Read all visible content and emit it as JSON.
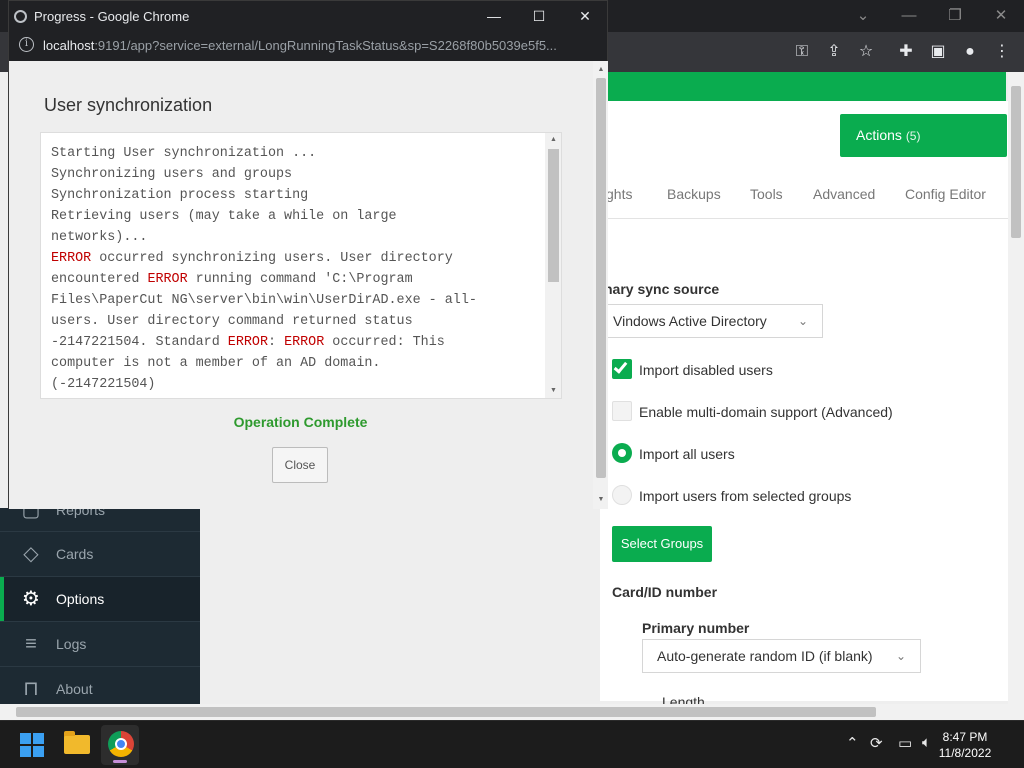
{
  "popup": {
    "window_title": "Progress - Google Chrome",
    "url_host": "localhost",
    "url_rest": ":9191/app?service=external/LongRunningTaskStatus&sp=S2268f80b5039e5f5...",
    "heading": "User synchronization",
    "log_lines": [
      {
        "parts": [
          {
            "t": "Starting User synchronization ...",
            "e": false
          }
        ]
      },
      {
        "parts": [
          {
            "t": "Synchronizing users and groups",
            "e": false
          }
        ]
      },
      {
        "parts": [
          {
            "t": "Synchronization process starting",
            "e": false
          }
        ]
      },
      {
        "parts": [
          {
            "t": "Retrieving users (may take a while on large",
            "e": false
          }
        ]
      },
      {
        "parts": [
          {
            "t": "networks)...",
            "e": false
          }
        ]
      },
      {
        "parts": [
          {
            "t": "ERROR",
            "e": true
          },
          {
            "t": " occurred synchronizing users. User directory",
            "e": false
          }
        ]
      },
      {
        "parts": [
          {
            "t": "encountered ",
            "e": false
          },
          {
            "t": "ERROR",
            "e": true
          },
          {
            "t": " running command 'C:\\Program",
            "e": false
          }
        ]
      },
      {
        "parts": [
          {
            "t": "Files\\PaperCut NG\\server\\bin\\win\\UserDirAD.exe - all-",
            "e": false
          }
        ]
      },
      {
        "parts": [
          {
            "t": "users. User directory command returned status",
            "e": false
          }
        ]
      },
      {
        "parts": [
          {
            "t": "-2147221504. Standard ",
            "e": false
          },
          {
            "t": "ERROR",
            "e": true
          },
          {
            "t": ": ",
            "e": false
          },
          {
            "t": "ERROR",
            "e": true
          },
          {
            "t": " occurred: This",
            "e": false
          }
        ]
      },
      {
        "parts": [
          {
            "t": "computer is not a member of an AD domain.",
            "e": false
          }
        ]
      },
      {
        "parts": [
          {
            "t": "(-2147221504)",
            "e": false
          }
        ]
      }
    ],
    "status": "Operation Complete",
    "close_label": "Close"
  },
  "main": {
    "actions_label": "Actions",
    "actions_count": "(5)",
    "tabs": [
      "ghts",
      "Backups",
      "Tools",
      "Advanced",
      "Config Editor"
    ],
    "primary_sync_source_label": "nary sync source",
    "primary_sync_source_value": "Vindows Active Directory",
    "import_disabled_label": "Import disabled users",
    "multi_domain_label": "Enable multi-domain support (Advanced)",
    "import_all_label": "Import all users",
    "import_groups_label": "Import users from selected groups",
    "select_groups_label": "Select Groups",
    "card_id_heading": "Card/ID number",
    "primary_number_label": "Primary number",
    "primary_number_value": "Auto-generate random ID (if blank)",
    "length_label": "Length"
  },
  "sidebar": {
    "items": [
      {
        "label": "Reports",
        "icon": "reports-icon"
      },
      {
        "label": "Cards",
        "icon": "cards-icon"
      },
      {
        "label": "Options",
        "icon": "gear-icon"
      },
      {
        "label": "Logs",
        "icon": "logs-icon"
      },
      {
        "label": "About",
        "icon": "bookmark-icon"
      }
    ]
  },
  "taskbar": {
    "time": "8:47 PM",
    "date": "11/8/2022"
  },
  "colors": {
    "accent_green": "#0aac4f",
    "error_red": "#c00000",
    "sidebar_bg": "#1d2a33"
  }
}
